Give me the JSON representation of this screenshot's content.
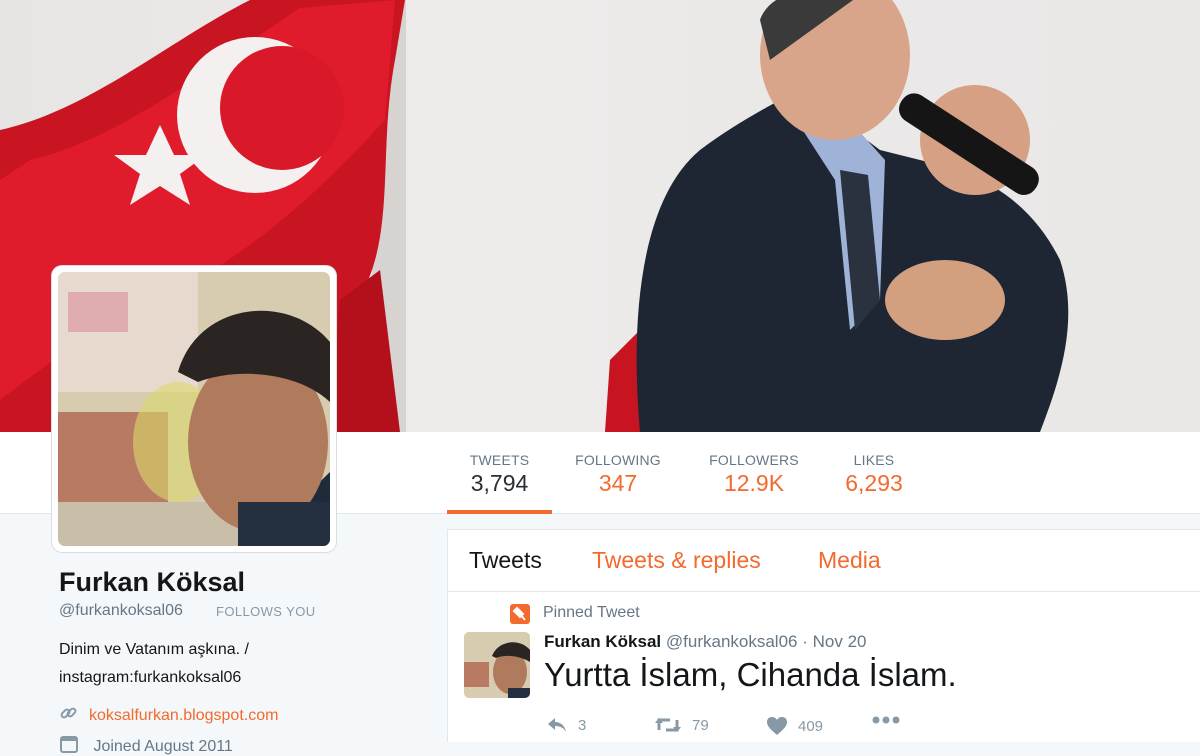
{
  "stats": [
    {
      "label": "TWEETS",
      "value": "3,794",
      "active": true
    },
    {
      "label": "FOLLOWING",
      "value": "347"
    },
    {
      "label": "FOLLOWERS",
      "value": "12.9K"
    },
    {
      "label": "LIKES",
      "value": "6,293"
    }
  ],
  "profile": {
    "name": "Furkan Köksal",
    "handle": "@furkankoksal06",
    "follows_you": "FOLLOWS YOU",
    "bio_line1": "Dinim ve Vatanım aşkına. /",
    "bio_line2": "instagram:furkankoksal06",
    "link": "koksalfurkan.blogspot.com",
    "joined": "Joined August 2011"
  },
  "tabs": [
    "Tweets",
    "Tweets & replies",
    "Media"
  ],
  "pinned_label": "Pinned Tweet",
  "tweet": {
    "name": "Furkan Köksal",
    "handle": "@furkankoksal06",
    "separator": "·",
    "date": "Nov 20",
    "text": "Yurtta İslam, Cihanda İslam.",
    "replies": "3",
    "retweets": "79",
    "likes": "409"
  },
  "icons": {
    "link": "link-icon",
    "calendar": "calendar-icon",
    "pin": "pin-icon",
    "reply": "reply-icon",
    "retweet": "retweet-icon",
    "like": "heart-icon",
    "more": "more-icon"
  },
  "colors": {
    "accent": "#f26a2d",
    "flag_red": "#e30a17",
    "text": "#14171a",
    "muted": "#657786"
  }
}
